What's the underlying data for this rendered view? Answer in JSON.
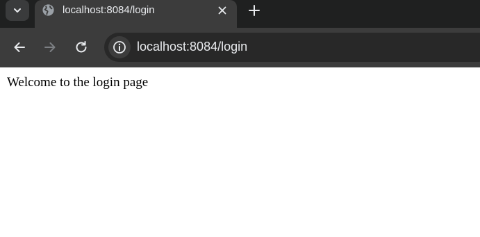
{
  "browser": {
    "tab": {
      "title": "localhost:8084/login",
      "favicon": "globe-icon"
    },
    "address_bar": {
      "url": "localhost:8084/login",
      "icon": "info-icon"
    },
    "toolbar": {
      "back_icon": "back-arrow-icon",
      "forward_icon": "forward-arrow-icon",
      "reload_icon": "reload-icon"
    },
    "colors": {
      "tabstrip": "#1f2020",
      "toolbar": "#3c3c3c",
      "omnibox": "#282828",
      "text": "#e8eaed"
    }
  },
  "page": {
    "body_text": "Welcome to the login page"
  }
}
